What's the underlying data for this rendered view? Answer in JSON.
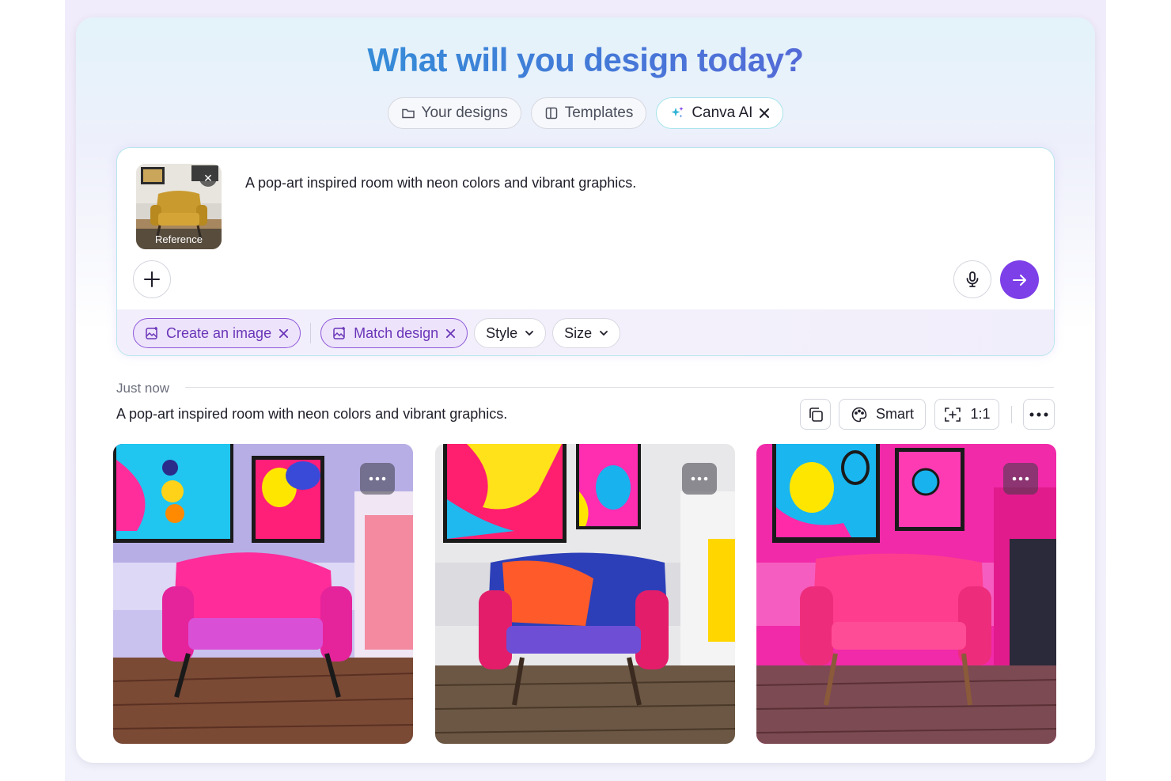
{
  "page": {
    "title": "What will you design today?"
  },
  "tabs": [
    {
      "label": "Your designs",
      "icon": "folder-icon"
    },
    {
      "label": "Templates",
      "icon": "templates-icon"
    },
    {
      "label": "Canva AI",
      "icon": "sparkle-icon",
      "active": true,
      "closable": true
    }
  ],
  "prompt": {
    "text": "A pop-art inspired room with neon colors and vibrant graphics.",
    "reference_label": "Reference",
    "add_icon": "plus-icon",
    "mic_icon": "microphone-icon",
    "send_icon": "arrow-right-icon"
  },
  "options": {
    "chips": [
      {
        "label": "Create an image",
        "selected": true
      },
      {
        "label": "Match design",
        "selected": true
      }
    ],
    "dropdowns": [
      {
        "label": "Style"
      },
      {
        "label": "Size"
      }
    ]
  },
  "history": {
    "timestamp": "Just now",
    "prompt": "A pop-art inspired room with neon colors and vibrant graphics.",
    "style_value": "Smart",
    "ratio_value": "1:1",
    "results_count": 3
  },
  "colors": {
    "accent_purple": "#7d3fe8",
    "chip_selected_bg": "#ede3fb",
    "title_gradient_start": "#1fa9d6",
    "title_gradient_end": "#6f4fd6"
  }
}
